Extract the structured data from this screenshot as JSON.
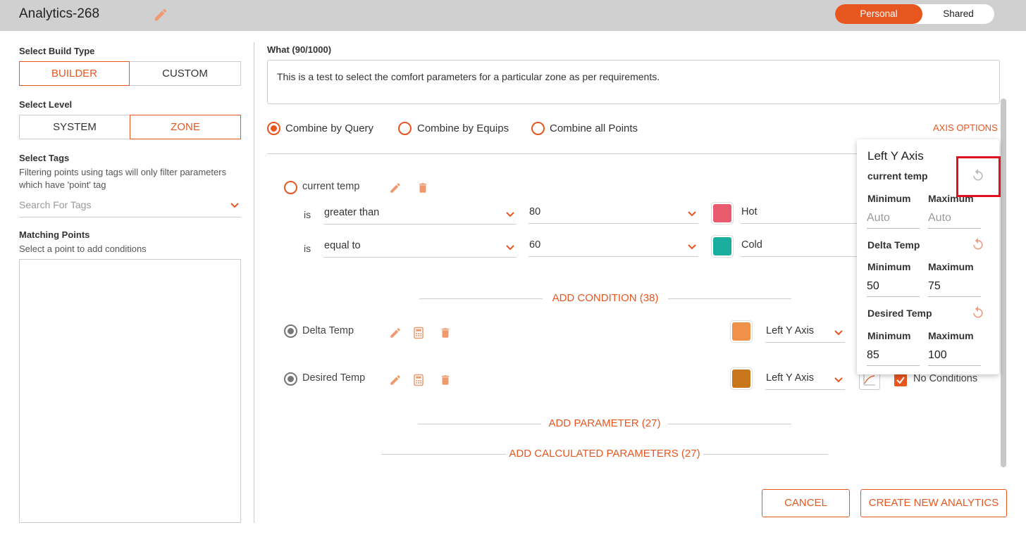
{
  "header": {
    "title": "Analytics-268",
    "toggle": {
      "personal": "Personal",
      "shared": "Shared"
    }
  },
  "left": {
    "build_type_label": "Select Build Type",
    "build_type_options": [
      "BUILDER",
      "CUSTOM"
    ],
    "level_label": "Select Level",
    "level_options": [
      "SYSTEM",
      "ZONE"
    ],
    "tags_label": "Select Tags",
    "tags_help": "Filtering points using tags will only filter parameters which have 'point' tag",
    "tags_placeholder": "Search For Tags",
    "matching_label": "Matching Points",
    "matching_help": "Select a point to add conditions"
  },
  "main": {
    "what_label": "What (90/1000)",
    "what_text": "This is a test to select the comfort parameters for a particular zone as per requirements.",
    "combine_options": [
      "Combine by Query",
      "Combine by Equips",
      "Combine all Points"
    ],
    "axis_options": "AXIS OPTIONS",
    "param1": {
      "name": "current temp",
      "conditions": [
        {
          "is": "is",
          "op": "greater than",
          "value": "80",
          "label": "Hot",
          "color": "#e85a6e"
        },
        {
          "is": "is",
          "op": "equal to",
          "value": "60",
          "label": "Cold",
          "color": "#1aae9f"
        }
      ]
    },
    "add_condition": "ADD CONDITION (38)",
    "param2": {
      "name": "Delta Temp",
      "color": "#f0914a",
      "axis": "Left Y Axis"
    },
    "param3": {
      "name": "Desired Temp",
      "color": "#c8761c",
      "axis": "Left Y Axis",
      "no_conditions": "No Conditions"
    },
    "add_parameter": "ADD PARAMETER (27)",
    "add_calculated": "ADD CALCULATED PARAMETERS (27)",
    "cancel": "CANCEL",
    "create": "CREATE NEW ANALYTICS"
  },
  "popup": {
    "title": "Left Y Axis",
    "sections": [
      {
        "name": "current temp",
        "min_label": "Minimum",
        "max_label": "Maximum",
        "min": "",
        "max": "",
        "min_ph": "Auto",
        "max_ph": "Auto"
      },
      {
        "name": "Delta Temp",
        "min_label": "Minimum",
        "max_label": "Maximum",
        "min": "50",
        "max": "75"
      },
      {
        "name": "Desired Temp",
        "min_label": "Minimum",
        "max_label": "Maximum",
        "min": "85",
        "max": "100"
      }
    ]
  },
  "colors": {
    "accent": "#e8561f",
    "header_bg": "#d0d0d0",
    "highlight": "#e0101e"
  }
}
